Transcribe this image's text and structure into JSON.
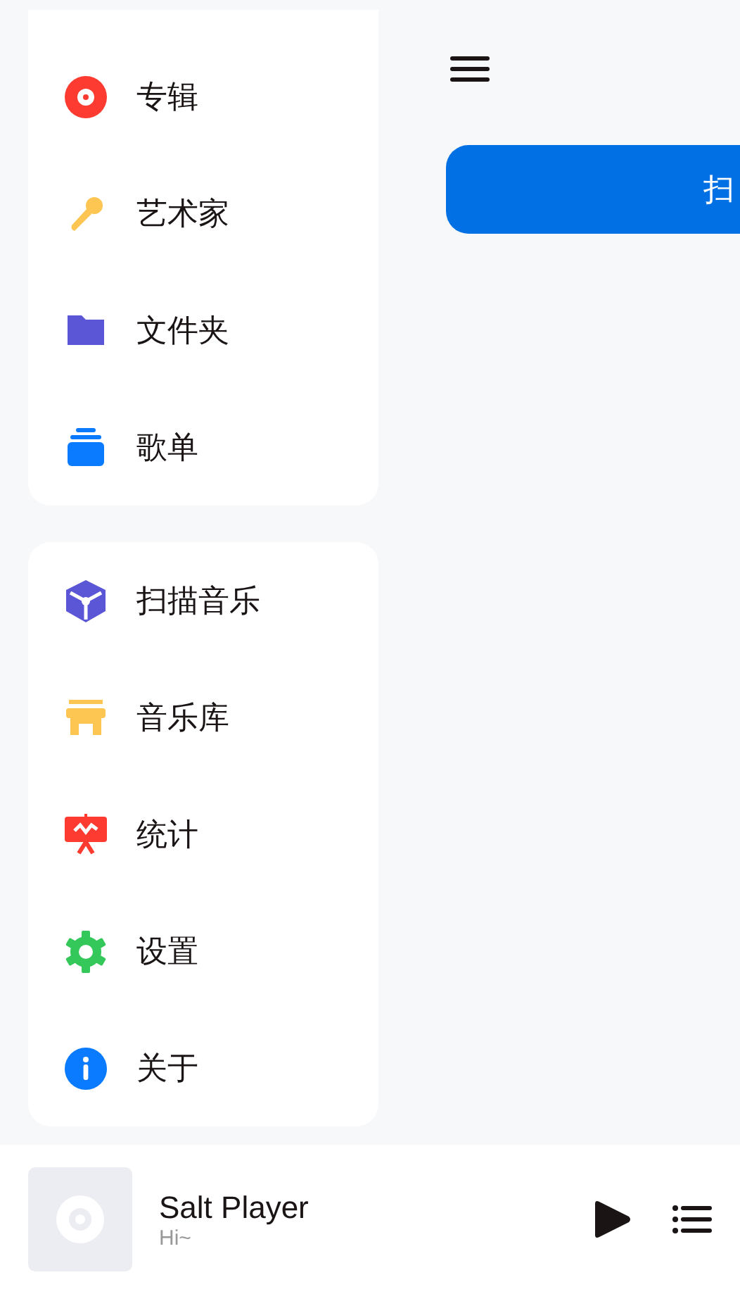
{
  "sidebar": {
    "groups": [
      {
        "items": [
          "专辑",
          "艺术家",
          "文件夹",
          "歌单"
        ]
      },
      {
        "items": [
          "扫描音乐",
          "音乐库",
          "统计",
          "设置",
          "关于"
        ]
      }
    ]
  },
  "main": {
    "scan_button": "扫"
  },
  "player": {
    "title": "Salt Player",
    "subtitle": "Hi~"
  }
}
